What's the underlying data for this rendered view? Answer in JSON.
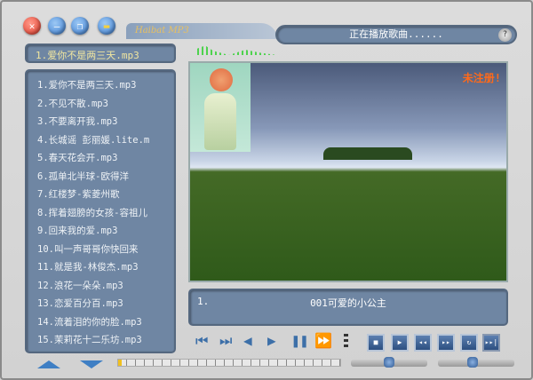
{
  "app": {
    "logo": "Haibat MP3"
  },
  "title_buttons": [
    "close",
    "minimize",
    "restore",
    "open-folder"
  ],
  "current_song": "1.爱你不是两三天.mp3",
  "status": {
    "text": "正在播放歌曲......",
    "help": "?"
  },
  "playlist": [
    "1.爱你不是两三天.mp3",
    "2.不见不散.mp3",
    "3.不要离开我.mp3",
    "4.长城谣 彭丽媛.lite.m",
    "5.春天花会开.mp3",
    "6.孤单北半球-欧得洋",
    "7.红楼梦-紫菱州歌",
    "8.挥着翅膀的女孩-容祖儿",
    "9.回来我的爱.mp3",
    "10.叫一声哥哥你快回来",
    "11.就是我-林俊杰.mp3",
    "12.浪花一朵朵.mp3",
    "13.恋爱百分百.mp3",
    "14.流着泪的你的脸.mp3",
    "15.茉莉花十二乐坊.mp3"
  ],
  "video": {
    "watermark": "未注册!"
  },
  "info": {
    "index": "1.",
    "title": "001可爱的小公主"
  },
  "controls": {
    "first": "⏮",
    "last": "⏭",
    "prev": "◀",
    "play": "▶",
    "pause": "❚❚",
    "ff": "⏩",
    "stop": "■",
    "play2": "▶",
    "rew": "◂◂",
    "fwd": "▸▸",
    "repeat": "↻",
    "next": "▸▸|"
  },
  "sliders": {
    "seek": 0.0,
    "volume": 0.45,
    "balance": 0.45
  }
}
